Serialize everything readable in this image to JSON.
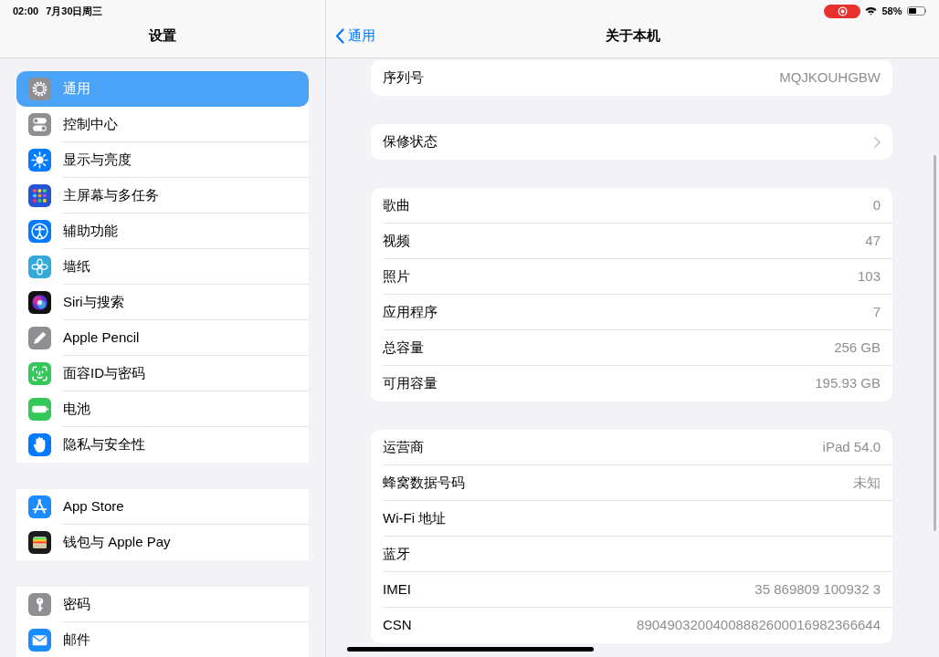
{
  "status_bar": {
    "time": "02:00",
    "date": "7月30日周三",
    "battery": "58%"
  },
  "sidebar": {
    "title": "设置",
    "groups": [
      {
        "items": [
          {
            "label": "通用",
            "selected": true
          },
          {
            "label": "控制中心",
            "selected": false
          },
          {
            "label": "显示与亮度",
            "selected": false
          },
          {
            "label": "主屏幕与多任务",
            "selected": false
          },
          {
            "label": "辅助功能",
            "selected": false
          },
          {
            "label": "墙纸",
            "selected": false
          },
          {
            "label": "Siri与搜索",
            "selected": false
          },
          {
            "label": "Apple Pencil",
            "selected": false
          },
          {
            "label": "面容ID与密码",
            "selected": false
          },
          {
            "label": "电池",
            "selected": false
          },
          {
            "label": "隐私与安全性",
            "selected": false
          }
        ]
      },
      {
        "items": [
          {
            "label": "App Store",
            "selected": false
          },
          {
            "label": "钱包与 Apple Pay",
            "selected": false
          }
        ]
      },
      {
        "items": [
          {
            "label": "密码",
            "selected": false
          },
          {
            "label": "邮件",
            "selected": false
          }
        ]
      }
    ]
  },
  "detail": {
    "back_label": "通用",
    "title": "关于本机",
    "groups": [
      {
        "rows": [
          {
            "label": "序列号",
            "value": "MQJKOUHGBW"
          }
        ]
      },
      {
        "rows": [
          {
            "label": "保修状态",
            "disclosure": true
          }
        ]
      },
      {
        "rows": [
          {
            "label": "歌曲",
            "value": "0"
          },
          {
            "label": "视频",
            "value": "47"
          },
          {
            "label": "照片",
            "value": "103"
          },
          {
            "label": "应用程序",
            "value": "7"
          },
          {
            "label": "总容量",
            "value": "256 GB"
          },
          {
            "label": "可用容量",
            "value": "195.93 GB"
          }
        ]
      },
      {
        "rows": [
          {
            "label": "运营商",
            "value": "iPad 54.0"
          },
          {
            "label": "蜂窝数据号码",
            "value": "未知"
          },
          {
            "label": "Wi-Fi 地址"
          },
          {
            "label": "蓝牙"
          },
          {
            "label": "IMEI",
            "value": "35 869809 100932 3"
          },
          {
            "label": "CSN",
            "value": "89049032004008882600016982366644"
          }
        ]
      }
    ]
  }
}
